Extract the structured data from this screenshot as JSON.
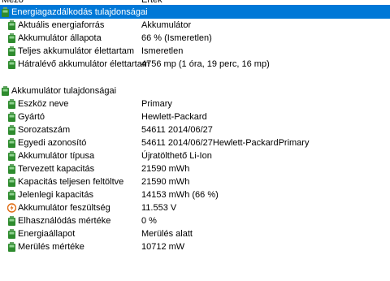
{
  "header": {
    "field": "Mező",
    "value": "Érték"
  },
  "sections": [
    {
      "title": "Energiagazdálkodás tulajdonságai",
      "rows": [
        {
          "name": "Aktuális energiaforrás",
          "value": "Akkumulátor",
          "icon": "battery-icon"
        },
        {
          "name": "Akkumulátor állapota",
          "value": "66 % (Ismeretlen)",
          "icon": "battery-icon"
        },
        {
          "name": "Teljes akkumulátor élettartam",
          "value": "Ismeretlen",
          "icon": "battery-icon"
        },
        {
          "name": "Hátralévő akkumulátor élettartam",
          "value": "4756 mp (1 óra, 19 perc, 16 mp)",
          "icon": "battery-icon"
        }
      ]
    },
    {
      "title": "Akkumulátor tulajdonságai",
      "rows": [
        {
          "name": "Eszköz neve",
          "value": "Primary",
          "icon": "battery-icon"
        },
        {
          "name": "Gyártó",
          "value": "Hewlett-Packard",
          "icon": "battery-icon"
        },
        {
          "name": "Sorozatszám",
          "value": "54611 2014/06/27",
          "icon": "battery-icon"
        },
        {
          "name": "Egyedi azonosító",
          "value": "54611 2014/06/27Hewlett-PackardPrimary",
          "icon": "battery-icon"
        },
        {
          "name": "Akkumulátor típusa",
          "value": "Újratölthető Li-Ion",
          "icon": "battery-icon"
        },
        {
          "name": "Tervezett kapacitás",
          "value": "21590 mWh",
          "icon": "battery-icon"
        },
        {
          "name": "Kapacitás teljesen feltöltve",
          "value": "21590 mWh",
          "icon": "battery-icon"
        },
        {
          "name": "Jelenlegi kapacitás",
          "value": "14153 mWh  (66 %)",
          "icon": "battery-icon"
        },
        {
          "name": "Akkumulátor feszültség",
          "value": "11.553 V",
          "icon": "voltage-icon"
        },
        {
          "name": "Elhasználódás mértéke",
          "value": "0 %",
          "icon": "battery-icon"
        },
        {
          "name": "Energiaállapot",
          "value": "Merülés alatt",
          "icon": "battery-icon"
        },
        {
          "name": "Merülés mértéke",
          "value": "10712 mW",
          "icon": "battery-icon"
        }
      ]
    }
  ],
  "colors": {
    "selection": "#0078d7",
    "battery_green": "#2e8b2e",
    "voltage_orange": "#e06a10"
  }
}
